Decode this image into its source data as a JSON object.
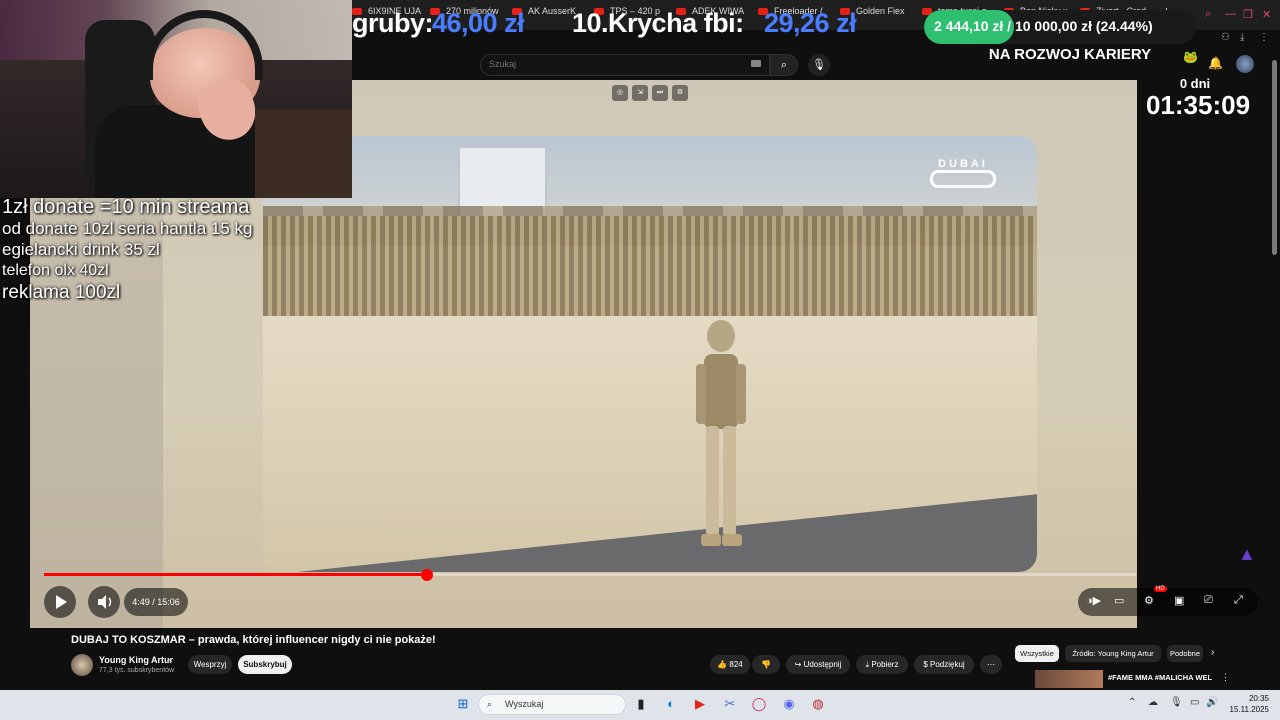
{
  "browser": {
    "tabs": [
      "6IX9INE UJA",
      "270 milionów",
      "AK AusserK",
      "TPS – 420 p",
      "ADEK WIWA",
      "Freeloader (",
      "Golden Fiex",
      "toma tussi g",
      "Ben Nicky x",
      "Zivert - Cred"
    ],
    "new_tab": "+"
  },
  "stream_overlay": {
    "stat_left_label": "gruby:",
    "stat_left_value": "46,00 zł",
    "stat_mid_label": "10.Krycha fbi:",
    "stat_mid_value": "29,26 zł",
    "goal_text": "2 444,10 zł / 10 000,00 zł (24.44%)",
    "goal_fraction": 0.2444,
    "goal_caption": "NA ROZWOJ KARIERY",
    "days": "0 dni",
    "timer": "01:35:09",
    "donations": [
      "1zł donate =10 min streama",
      "od donate 10zl seria hantla 15 kg",
      "egielancki drink 35 zl",
      "telefon olx 40zl",
      "reklama 100zl"
    ]
  },
  "youtube": {
    "search_placeholder": "Szukaj",
    "search_icon": "search-icon",
    "mic_icon": "microphone-icon",
    "video": {
      "watermark": "DUBAI",
      "time_display": "4:49 / 15:06",
      "progress_fraction": 0.3508,
      "hd_badge": "HD"
    },
    "title": "DUBAJ TO KOSZMAR – prawda, której influencer nigdy ci nie pokaże!",
    "channel": {
      "name": "Young King Artur",
      "subscribers": "77,3 tys. subskrybentów",
      "support_label": "Wesprzyj",
      "subscribe_label": "Subskrybuj"
    },
    "actions": {
      "likes": "824",
      "share": "Udostępnij",
      "download": "Pobierz",
      "thanks": "Podziękuj"
    },
    "chips": [
      "Wszystkie",
      "Źródło: Young King Artur",
      "Podobne"
    ],
    "side_video_title": "#FAME MMA #MALICHA WEL"
  },
  "taskbar": {
    "search_placeholder": "Wyszukaj",
    "time": "20:35",
    "date": "15.11.2025"
  },
  "colors": {
    "accent_red": "#ff0000",
    "stat_value": "#4a7cff",
    "goal_green": "#2fbf71",
    "page_bg": "#0f0f0f"
  }
}
